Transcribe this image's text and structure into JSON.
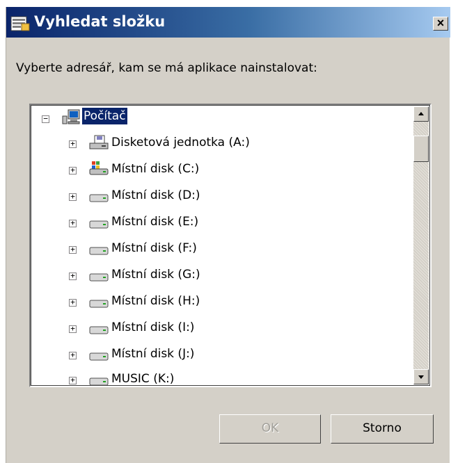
{
  "window": {
    "title": "Vyhledat složku",
    "close_glyph": "×"
  },
  "prompt": "Vyberte adresář, kam se má aplikace nainstalovat:",
  "tree": {
    "root": {
      "label": "Počítač",
      "expander": "−",
      "icon": "computer-icon",
      "selected": true
    },
    "items": [
      {
        "label": "Disketová jednotka (A:)",
        "icon": "floppy-drive-icon",
        "expander": "+"
      },
      {
        "label": "Místní disk (C:)",
        "icon": "system-drive-icon",
        "expander": "+"
      },
      {
        "label": "Místní disk (D:)",
        "icon": "hard-drive-icon",
        "expander": "+"
      },
      {
        "label": "Místní disk (E:)",
        "icon": "hard-drive-icon",
        "expander": "+"
      },
      {
        "label": "Místní disk (F:)",
        "icon": "hard-drive-icon",
        "expander": "+"
      },
      {
        "label": "Místní disk (G:)",
        "icon": "hard-drive-icon",
        "expander": "+"
      },
      {
        "label": "Místní disk (H:)",
        "icon": "hard-drive-icon",
        "expander": "+"
      },
      {
        "label": "Místní disk (I:)",
        "icon": "hard-drive-icon",
        "expander": "+"
      },
      {
        "label": "Místní disk (J:)",
        "icon": "hard-drive-icon",
        "expander": "+"
      },
      {
        "label": "MUSIC (K:)",
        "icon": "hard-drive-icon",
        "expander": "+"
      }
    ]
  },
  "buttons": {
    "ok_label": "OK",
    "cancel_label": "Storno"
  },
  "colors": {
    "titlebar_start": "#0a246a",
    "titlebar_end": "#a6caf0",
    "dialog_face": "#d4d0c8",
    "selection": "#0a246a"
  }
}
